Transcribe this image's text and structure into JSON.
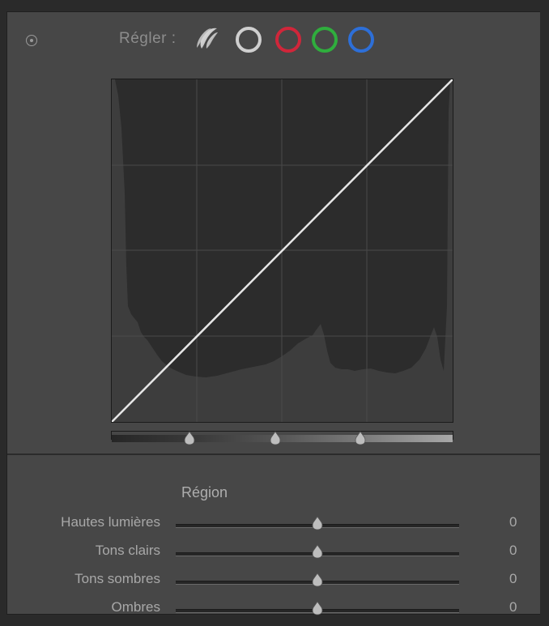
{
  "header": {
    "adjust_label": "Régler :",
    "channels": [
      {
        "name": "rgb-point-curve",
        "color": "#d0d0d0"
      },
      {
        "name": "rgb",
        "color": "#cfcfcf"
      },
      {
        "name": "red",
        "color": "#d0263a"
      },
      {
        "name": "green",
        "color": "#2fae3d"
      },
      {
        "name": "blue",
        "color": "#2d6fd8"
      }
    ]
  },
  "curve": {
    "line_color": "#e6e6e6",
    "split_points": [
      0.25,
      0.5,
      0.75
    ]
  },
  "region": {
    "title": "Région",
    "sliders": [
      {
        "label": "Hautes lumières",
        "value": "0",
        "position": 0.5
      },
      {
        "label": "Tons clairs",
        "value": "0",
        "position": 0.5
      },
      {
        "label": "Tons sombres",
        "value": "0",
        "position": 0.5
      },
      {
        "label": "Ombres",
        "value": "0",
        "position": 0.5
      }
    ]
  }
}
